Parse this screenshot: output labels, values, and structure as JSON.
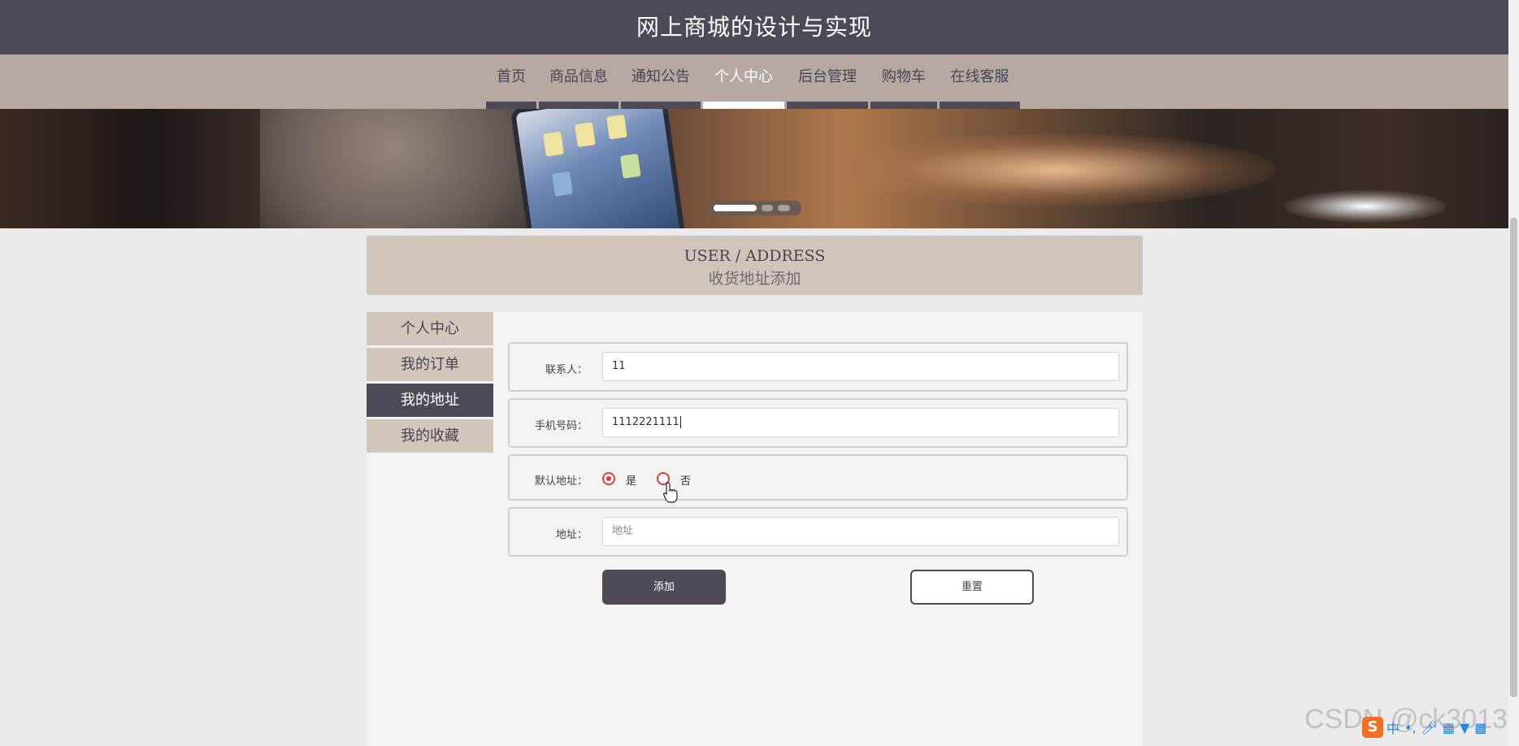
{
  "header": {
    "site_title": "网上商城的设计与实现"
  },
  "nav": {
    "items": [
      {
        "label": "首页"
      },
      {
        "label": "商品信息"
      },
      {
        "label": "通知公告"
      },
      {
        "label": "个人中心",
        "active": true
      },
      {
        "label": "后台管理"
      },
      {
        "label": "购物车"
      },
      {
        "label": "在线客服"
      }
    ]
  },
  "banner": {
    "slides": 3,
    "active_slide": 1
  },
  "page_title": {
    "en": "USER / ADDRESS",
    "cn": "收货地址添加"
  },
  "side_menu": {
    "items": [
      {
        "label": "个人中心"
      },
      {
        "label": "我的订单"
      },
      {
        "label": "我的地址",
        "active": true
      },
      {
        "label": "我的收藏"
      }
    ]
  },
  "form": {
    "contact": {
      "label": "联系人：",
      "value": "11"
    },
    "phone": {
      "label": "手机号码：",
      "value": "1112221111"
    },
    "default_address": {
      "label": "默认地址：",
      "option_yes": "是",
      "option_no": "否",
      "selected": "是"
    },
    "address": {
      "label": "地址：",
      "placeholder": "地址",
      "value": ""
    },
    "submit_label": "添加",
    "reset_label": "重置"
  },
  "watermark": "CSDN @ck3013",
  "ime": {
    "logo": "S",
    "lang": "中"
  },
  "colors": {
    "header_bg": "#4f4955",
    "nav_bg": "#b5a9a2",
    "title_box_bg": "#cfc5bb",
    "side_item_bg": "#d1c7bd",
    "radio_accent": "#e53935"
  }
}
